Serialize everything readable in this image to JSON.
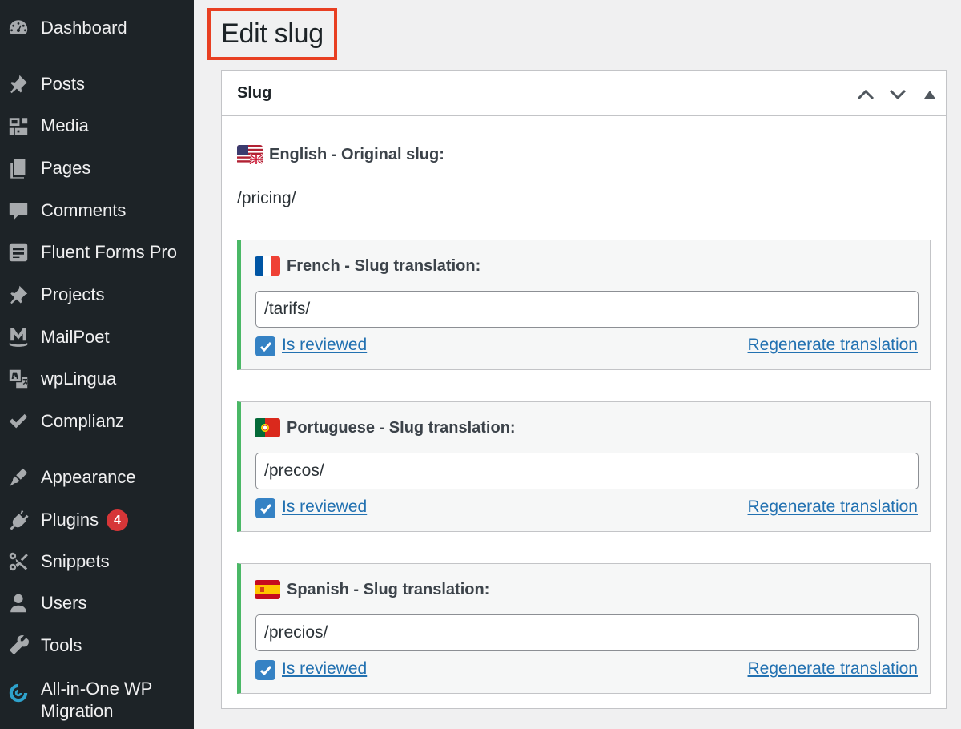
{
  "sidebar": {
    "items": [
      {
        "label": "Dashboard",
        "icon": "dashboard-icon"
      },
      {
        "label": "Posts",
        "icon": "pin-icon"
      },
      {
        "label": "Media",
        "icon": "media-icon"
      },
      {
        "label": "Pages",
        "icon": "pages-icon"
      },
      {
        "label": "Comments",
        "icon": "comment-icon"
      },
      {
        "label": "Fluent Forms Pro",
        "icon": "forms-icon"
      },
      {
        "label": "Projects",
        "icon": "pin-icon"
      },
      {
        "label": "MailPoet",
        "icon": "mailpoet-icon"
      },
      {
        "label": "wpLingua",
        "icon": "translate-icon"
      },
      {
        "label": "Complianz",
        "icon": "check-icon"
      },
      {
        "label": "Appearance",
        "icon": "brush-icon"
      },
      {
        "label": "Plugins",
        "icon": "plug-icon",
        "badge": "4"
      },
      {
        "label": "Snippets",
        "icon": "scissors-icon"
      },
      {
        "label": "Users",
        "icon": "user-icon"
      },
      {
        "label": "Tools",
        "icon": "wrench-icon"
      },
      {
        "label": "All-in-One WP Migration",
        "icon": "migration-icon"
      }
    ]
  },
  "page": {
    "title": "Edit slug"
  },
  "postbox": {
    "title": "Slug",
    "original": {
      "flag": "us-uk-flag",
      "label": "English - Original slug:",
      "slug": "/pricing/"
    },
    "translations": [
      {
        "flag": "fr-flag",
        "label": "French - Slug translation:",
        "value": "/tarifs/",
        "reviewed_label": "Is reviewed",
        "reviewed": true,
        "regenerate_label": "Regenerate translation"
      },
      {
        "flag": "pt-flag",
        "label": "Portuguese - Slug translation:",
        "value": "/precos/",
        "reviewed_label": "Is reviewed",
        "reviewed": true,
        "regenerate_label": "Regenerate translation"
      },
      {
        "flag": "es-flag",
        "label": "Spanish - Slug translation:",
        "value": "/precios/",
        "reviewed_label": "Is reviewed",
        "reviewed": true,
        "regenerate_label": "Regenerate translation"
      }
    ]
  },
  "colors": {
    "sidebar_bg": "#1d2327",
    "accent_blue": "#2271b1",
    "highlight_red": "#e83f22",
    "reviewed_green": "#4ab866",
    "badge_red": "#d63638"
  }
}
